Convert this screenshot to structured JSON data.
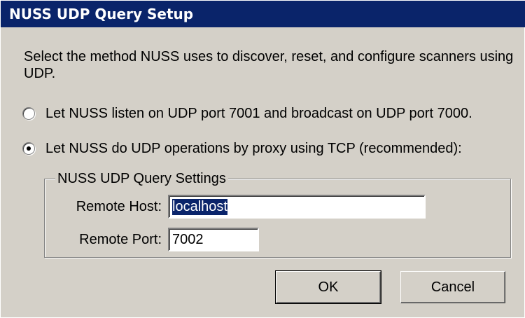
{
  "dialog": {
    "title": "NUSS UDP Query Setup",
    "description": "Select the method NUSS uses to discover, reset, and configure scanners using UDP."
  },
  "options": [
    {
      "label": "Let NUSS listen on UDP port 7001 and broadcast on UDP port 7000.",
      "checked": false
    },
    {
      "label": "Let NUSS do UDP operations by proxy using TCP (recommended):",
      "checked": true
    }
  ],
  "settings": {
    "group_label": "NUSS UDP Query Settings",
    "remote_host_label": "Remote Host:",
    "remote_host_value": "localhost",
    "remote_port_label": "Remote Port:",
    "remote_port_value": "7002"
  },
  "buttons": {
    "ok_label": "OK",
    "cancel_label": "Cancel"
  },
  "colors": {
    "titlebar": "#0a246a",
    "face": "#d4d0c8",
    "selection": "#0a246a"
  }
}
